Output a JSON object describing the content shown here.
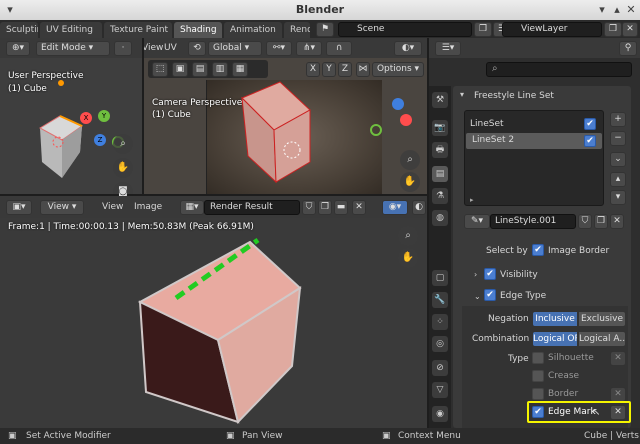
{
  "window": {
    "title": "Blender"
  },
  "workspace_tabs": [
    {
      "label": "Sculpting",
      "active": false
    },
    {
      "label": "UV Editing",
      "active": false
    },
    {
      "label": "Texture Paint",
      "active": false
    },
    {
      "label": "Shading",
      "active": true
    },
    {
      "label": "Animation",
      "active": false
    },
    {
      "label": "Rend",
      "active": false
    }
  ],
  "scene": {
    "name": "Scene",
    "view_layer": "ViewLayer"
  },
  "viewport_left": {
    "mode": "Edit Mode",
    "title": "User Perspective",
    "object": "(1) Cube",
    "axes": {
      "x": "X",
      "y": "Y",
      "z": "Z"
    }
  },
  "viewport_camera": {
    "title": "Camera Perspective",
    "object": "(1) Cube",
    "transform": "Global",
    "menus": {
      "view": "View",
      "uv": "UV"
    },
    "options_label": "Options",
    "axes": {
      "x": "X",
      "y": "Y",
      "z": "Z"
    }
  },
  "image_editor": {
    "view_menu": "View",
    "view_menu2": "View",
    "image_menu": "Image",
    "image_name": "Render Result",
    "info": "Frame:1 | Time:00:00.13 | Mem:50.83M (Peak 66.91M)"
  },
  "properties": {
    "panel_title": "Freestyle Line Set",
    "linesets": [
      {
        "name": "LineSet",
        "checked": true,
        "selected": false
      },
      {
        "name": "LineSet 2",
        "checked": true,
        "selected": true
      }
    ],
    "linestyle": "LineStyle.001",
    "select_by": {
      "label": "Select by",
      "option": "Image Border",
      "checked": true
    },
    "visibility": {
      "label": "Visibility",
      "checked": true
    },
    "edge_type": {
      "label": "Edge Type",
      "checked": true
    },
    "negation": {
      "label": "Negation",
      "options": [
        "Inclusive",
        "Exclusive"
      ],
      "active": "Inclusive"
    },
    "combination": {
      "label": "Combination",
      "options": [
        "Logical OR",
        "Logical A..."
      ],
      "active": "Logical OR"
    },
    "type_label": "Type",
    "types": [
      {
        "name": "Silhouette",
        "checked": false
      },
      {
        "name": "Crease",
        "checked": false
      },
      {
        "name": "Border",
        "checked": false
      },
      {
        "name": "Edge Mark",
        "checked": true
      }
    ]
  },
  "statusbar": {
    "left": "Set Active Modifier",
    "middle": "Pan View",
    "right": "Context Menu",
    "info": "Cube | Verts"
  },
  "colors": {
    "accent": "#4772b3",
    "highlight": "#f5f500",
    "edge_mark": "#22cc22"
  }
}
